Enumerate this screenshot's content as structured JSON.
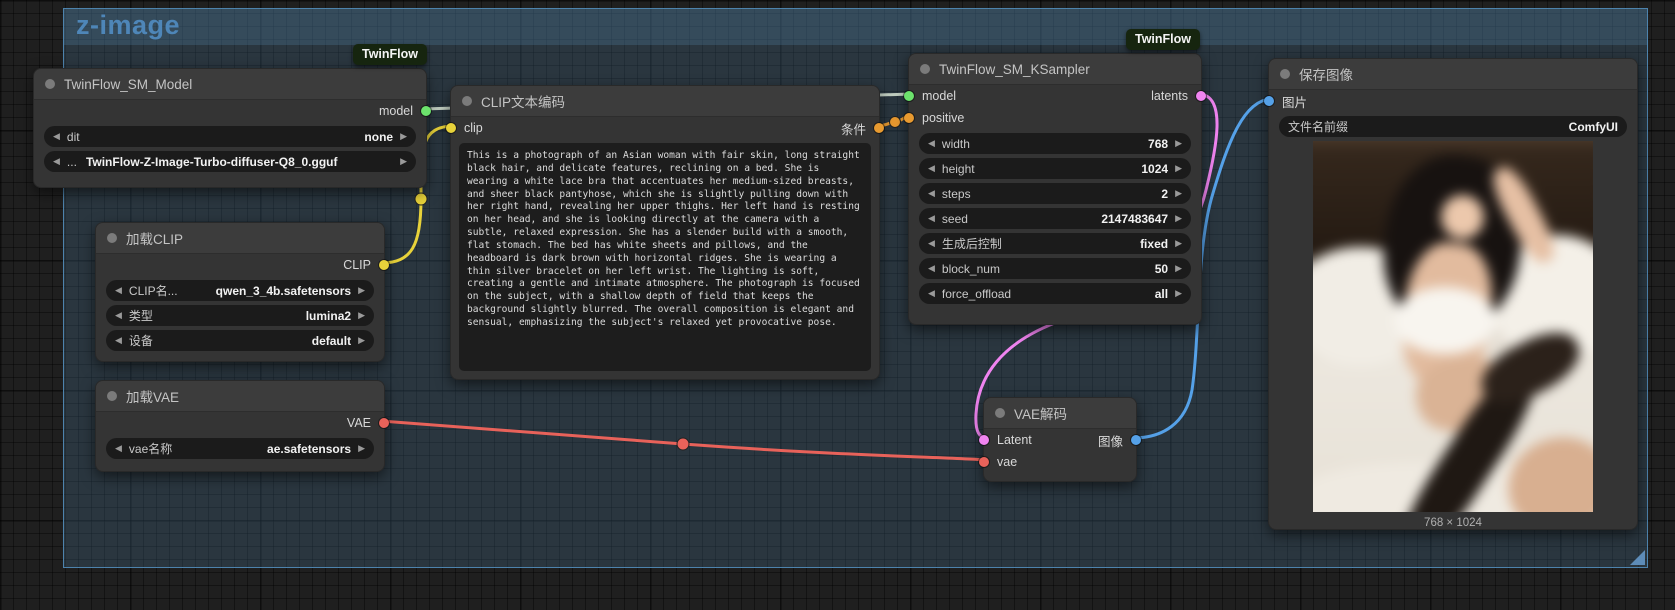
{
  "group": {
    "title": "z-image"
  },
  "badges": [
    {
      "label": "TwinFlow"
    },
    {
      "label": "TwinFlow"
    }
  ],
  "colors": {
    "group_border": "#4d83ad",
    "wire_model": "#c2cfc2",
    "wire_clip": "#e8d23a",
    "wire_condition": "#e89a30",
    "wire_vae": "#e8625a",
    "wire_latent": "#f084f0",
    "wire_image": "#55a1e8"
  },
  "nodes": {
    "model_loader": {
      "title": "TwinFlow_SM_Model",
      "outputs": [
        {
          "label": "model"
        }
      ],
      "widgets": [
        {
          "label": "dit",
          "value": "none"
        },
        {
          "label": "...",
          "value": "TwinFlow-Z-Image-Turbo-diffuser-Q8_0.gguf"
        }
      ]
    },
    "clip_loader": {
      "title": "加载CLIP",
      "outputs": [
        {
          "label": "CLIP"
        }
      ],
      "widgets": [
        {
          "label": "CLIP名...",
          "value": "qwen_3_4b.safetensors"
        },
        {
          "label": "类型",
          "value": "lumina2"
        },
        {
          "label": "设备",
          "value": "default"
        }
      ]
    },
    "vae_loader": {
      "title": "加载VAE",
      "outputs": [
        {
          "label": "VAE"
        }
      ],
      "widgets": [
        {
          "label": "vae名称",
          "value": "ae.safetensors"
        }
      ]
    },
    "clip_encode": {
      "title": "CLIP文本编码",
      "inputs": [
        {
          "label": "clip"
        }
      ],
      "outputs": [
        {
          "label": "条件"
        }
      ],
      "prompt": "This is a photograph of an Asian woman with fair skin, long straight black hair, and delicate features, reclining on a bed. She is wearing a white lace bra that accentuates her medium-sized breasts, and sheer black pantyhose, which she is slightly pulling down with her right hand, revealing her upper thighs. Her left hand is resting on her head, and she is looking directly at the camera with a subtle, relaxed expression. She has a slender build with a smooth, flat stomach. The bed has white sheets and pillows, and the headboard is dark brown with horizontal ridges. She is wearing a thin silver bracelet on her left wrist. The lighting is soft, creating a gentle and intimate atmosphere. The photograph is focused on the subject, with a shallow depth of field that keeps the background slightly blurred. The overall composition is elegant and sensual, emphasizing the subject's relaxed yet provocative pose."
    },
    "ksampler": {
      "title": "TwinFlow_SM_KSampler",
      "inputs": [
        {
          "label": "model"
        },
        {
          "label": "positive"
        }
      ],
      "outputs": [
        {
          "label": "latents"
        }
      ],
      "widgets": [
        {
          "label": "width",
          "value": "768"
        },
        {
          "label": "height",
          "value": "1024"
        },
        {
          "label": "steps",
          "value": "2"
        },
        {
          "label": "seed",
          "value": "2147483647"
        },
        {
          "label": "生成后控制",
          "value": "fixed"
        },
        {
          "label": "block_num",
          "value": "50"
        },
        {
          "label": "force_offload",
          "value": "all"
        }
      ]
    },
    "vae_decode": {
      "title": "VAE解码",
      "inputs": [
        {
          "label": "Latent"
        },
        {
          "label": "vae"
        }
      ],
      "outputs": [
        {
          "label": "图像"
        }
      ]
    },
    "save_image": {
      "title": "保存图像",
      "inputs": [
        {
          "label": "图片"
        }
      ],
      "widgets": [
        {
          "label": "文件名前缀",
          "value": "ComfyUI"
        }
      ],
      "preview_caption": "768 × 1024"
    }
  }
}
